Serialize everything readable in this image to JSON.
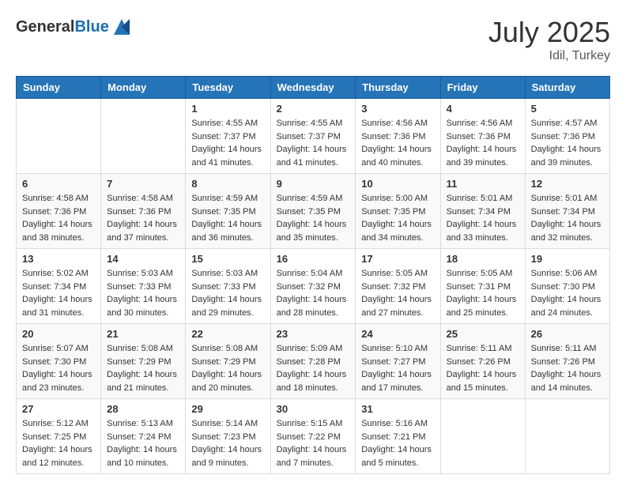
{
  "header": {
    "logo_general": "General",
    "logo_blue": "Blue",
    "month_year": "July 2025",
    "location": "Idil, Turkey"
  },
  "weekdays": [
    "Sunday",
    "Monday",
    "Tuesday",
    "Wednesday",
    "Thursday",
    "Friday",
    "Saturday"
  ],
  "weeks": [
    [
      {
        "day": "",
        "sunrise": "",
        "sunset": "",
        "daylight": ""
      },
      {
        "day": "",
        "sunrise": "",
        "sunset": "",
        "daylight": ""
      },
      {
        "day": "1",
        "sunrise": "Sunrise: 4:55 AM",
        "sunset": "Sunset: 7:37 PM",
        "daylight": "Daylight: 14 hours and 41 minutes."
      },
      {
        "day": "2",
        "sunrise": "Sunrise: 4:55 AM",
        "sunset": "Sunset: 7:37 PM",
        "daylight": "Daylight: 14 hours and 41 minutes."
      },
      {
        "day": "3",
        "sunrise": "Sunrise: 4:56 AM",
        "sunset": "Sunset: 7:36 PM",
        "daylight": "Daylight: 14 hours and 40 minutes."
      },
      {
        "day": "4",
        "sunrise": "Sunrise: 4:56 AM",
        "sunset": "Sunset: 7:36 PM",
        "daylight": "Daylight: 14 hours and 39 minutes."
      },
      {
        "day": "5",
        "sunrise": "Sunrise: 4:57 AM",
        "sunset": "Sunset: 7:36 PM",
        "daylight": "Daylight: 14 hours and 39 minutes."
      }
    ],
    [
      {
        "day": "6",
        "sunrise": "Sunrise: 4:58 AM",
        "sunset": "Sunset: 7:36 PM",
        "daylight": "Daylight: 14 hours and 38 minutes."
      },
      {
        "day": "7",
        "sunrise": "Sunrise: 4:58 AM",
        "sunset": "Sunset: 7:36 PM",
        "daylight": "Daylight: 14 hours and 37 minutes."
      },
      {
        "day": "8",
        "sunrise": "Sunrise: 4:59 AM",
        "sunset": "Sunset: 7:35 PM",
        "daylight": "Daylight: 14 hours and 36 minutes."
      },
      {
        "day": "9",
        "sunrise": "Sunrise: 4:59 AM",
        "sunset": "Sunset: 7:35 PM",
        "daylight": "Daylight: 14 hours and 35 minutes."
      },
      {
        "day": "10",
        "sunrise": "Sunrise: 5:00 AM",
        "sunset": "Sunset: 7:35 PM",
        "daylight": "Daylight: 14 hours and 34 minutes."
      },
      {
        "day": "11",
        "sunrise": "Sunrise: 5:01 AM",
        "sunset": "Sunset: 7:34 PM",
        "daylight": "Daylight: 14 hours and 33 minutes."
      },
      {
        "day": "12",
        "sunrise": "Sunrise: 5:01 AM",
        "sunset": "Sunset: 7:34 PM",
        "daylight": "Daylight: 14 hours and 32 minutes."
      }
    ],
    [
      {
        "day": "13",
        "sunrise": "Sunrise: 5:02 AM",
        "sunset": "Sunset: 7:34 PM",
        "daylight": "Daylight: 14 hours and 31 minutes."
      },
      {
        "day": "14",
        "sunrise": "Sunrise: 5:03 AM",
        "sunset": "Sunset: 7:33 PM",
        "daylight": "Daylight: 14 hours and 30 minutes."
      },
      {
        "day": "15",
        "sunrise": "Sunrise: 5:03 AM",
        "sunset": "Sunset: 7:33 PM",
        "daylight": "Daylight: 14 hours and 29 minutes."
      },
      {
        "day": "16",
        "sunrise": "Sunrise: 5:04 AM",
        "sunset": "Sunset: 7:32 PM",
        "daylight": "Daylight: 14 hours and 28 minutes."
      },
      {
        "day": "17",
        "sunrise": "Sunrise: 5:05 AM",
        "sunset": "Sunset: 7:32 PM",
        "daylight": "Daylight: 14 hours and 27 minutes."
      },
      {
        "day": "18",
        "sunrise": "Sunrise: 5:05 AM",
        "sunset": "Sunset: 7:31 PM",
        "daylight": "Daylight: 14 hours and 25 minutes."
      },
      {
        "day": "19",
        "sunrise": "Sunrise: 5:06 AM",
        "sunset": "Sunset: 7:30 PM",
        "daylight": "Daylight: 14 hours and 24 minutes."
      }
    ],
    [
      {
        "day": "20",
        "sunrise": "Sunrise: 5:07 AM",
        "sunset": "Sunset: 7:30 PM",
        "daylight": "Daylight: 14 hours and 23 minutes."
      },
      {
        "day": "21",
        "sunrise": "Sunrise: 5:08 AM",
        "sunset": "Sunset: 7:29 PM",
        "daylight": "Daylight: 14 hours and 21 minutes."
      },
      {
        "day": "22",
        "sunrise": "Sunrise: 5:08 AM",
        "sunset": "Sunset: 7:29 PM",
        "daylight": "Daylight: 14 hours and 20 minutes."
      },
      {
        "day": "23",
        "sunrise": "Sunrise: 5:09 AM",
        "sunset": "Sunset: 7:28 PM",
        "daylight": "Daylight: 14 hours and 18 minutes."
      },
      {
        "day": "24",
        "sunrise": "Sunrise: 5:10 AM",
        "sunset": "Sunset: 7:27 PM",
        "daylight": "Daylight: 14 hours and 17 minutes."
      },
      {
        "day": "25",
        "sunrise": "Sunrise: 5:11 AM",
        "sunset": "Sunset: 7:26 PM",
        "daylight": "Daylight: 14 hours and 15 minutes."
      },
      {
        "day": "26",
        "sunrise": "Sunrise: 5:11 AM",
        "sunset": "Sunset: 7:26 PM",
        "daylight": "Daylight: 14 hours and 14 minutes."
      }
    ],
    [
      {
        "day": "27",
        "sunrise": "Sunrise: 5:12 AM",
        "sunset": "Sunset: 7:25 PM",
        "daylight": "Daylight: 14 hours and 12 minutes."
      },
      {
        "day": "28",
        "sunrise": "Sunrise: 5:13 AM",
        "sunset": "Sunset: 7:24 PM",
        "daylight": "Daylight: 14 hours and 10 minutes."
      },
      {
        "day": "29",
        "sunrise": "Sunrise: 5:14 AM",
        "sunset": "Sunset: 7:23 PM",
        "daylight": "Daylight: 14 hours and 9 minutes."
      },
      {
        "day": "30",
        "sunrise": "Sunrise: 5:15 AM",
        "sunset": "Sunset: 7:22 PM",
        "daylight": "Daylight: 14 hours and 7 minutes."
      },
      {
        "day": "31",
        "sunrise": "Sunrise: 5:16 AM",
        "sunset": "Sunset: 7:21 PM",
        "daylight": "Daylight: 14 hours and 5 minutes."
      },
      {
        "day": "",
        "sunrise": "",
        "sunset": "",
        "daylight": ""
      },
      {
        "day": "",
        "sunrise": "",
        "sunset": "",
        "daylight": ""
      }
    ]
  ]
}
